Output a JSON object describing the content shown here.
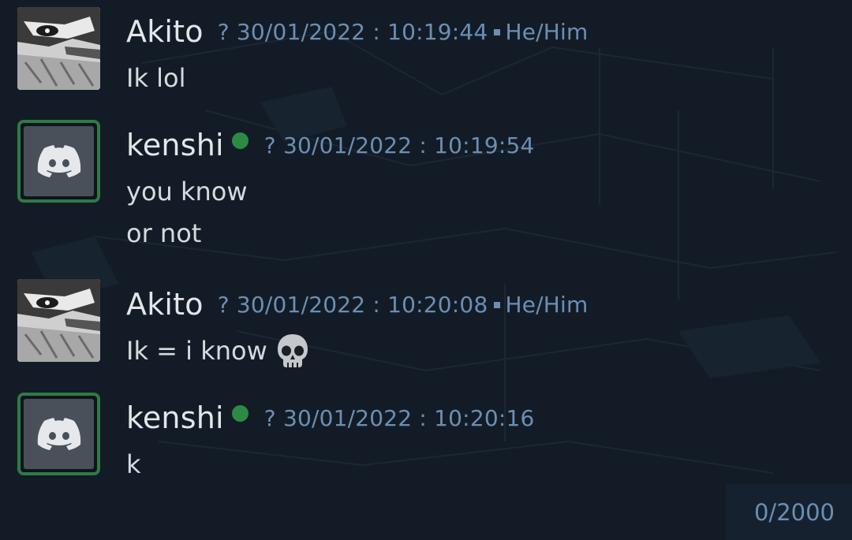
{
  "messages": [
    {
      "author": "Akito",
      "meta_prefix": "?",
      "timestamp": "30/01/2022 : 10:19:44",
      "pronouns": "He/Him",
      "lines": [
        "Ik lol"
      ],
      "avatar": "manga-avatar"
    },
    {
      "author": "kenshi",
      "online": true,
      "meta_prefix": "?",
      "timestamp": "30/01/2022 : 10:19:54",
      "lines": [
        "you know",
        "or not"
      ],
      "avatar": "discord-logo-icon"
    },
    {
      "author": "Akito",
      "meta_prefix": "?",
      "timestamp": "30/01/2022 : 10:20:08",
      "pronouns": "He/Him",
      "lines": [
        "Ik = i know"
      ],
      "emoji": "skull-icon",
      "avatar": "manga-avatar"
    },
    {
      "author": "kenshi",
      "online": true,
      "meta_prefix": "?",
      "timestamp": "30/01/2022 : 10:20:16",
      "lines": [
        "k"
      ],
      "avatar": "discord-logo-icon"
    }
  ],
  "composer": {
    "char_counter": "0/2000"
  },
  "colors": {
    "background": "#131c26",
    "timestamp": "#6b8fb5",
    "online": "#2c8a44",
    "bot_border": "#2f7a45"
  }
}
